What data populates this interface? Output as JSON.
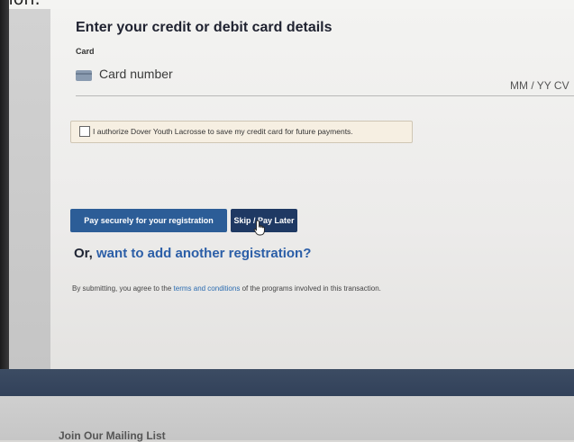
{
  "top_partial_text": "tion:",
  "payment": {
    "heading": "Enter your credit or debit card details",
    "card_label": "Card",
    "card_number_placeholder": "Card number",
    "expiry_cvc_placeholder": "MM / YY CV",
    "authorize_text": "I authorize Dover Youth Lacrosse to save my credit card for future payments.",
    "pay_button": "Pay securely for your registration",
    "skip_button": "Skip / Pay Later",
    "or_prefix": "Or, ",
    "add_registration_link": "want to add another registration?",
    "terms_prefix": "By submitting, you agree to the ",
    "terms_link": "terms and conditions",
    "terms_suffix": " of the programs involved in this transaction."
  },
  "footer": {
    "mailing_list": "Join Our Mailing List"
  },
  "colors": {
    "pay_button": "#2c5d97",
    "skip_button": "#1f3963",
    "link": "#2b5ea7",
    "band": "#3c4c63"
  }
}
